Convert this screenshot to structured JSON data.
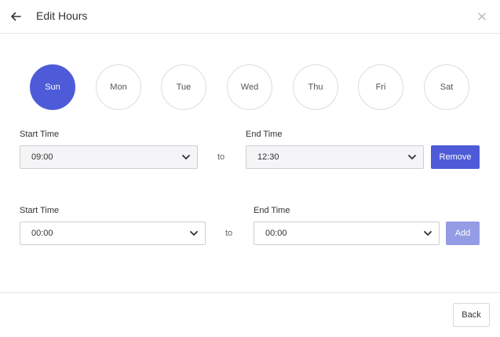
{
  "header": {
    "title": "Edit Hours",
    "back_icon": "arrow-left-icon",
    "close_icon": "close-icon"
  },
  "days": [
    {
      "label": "Sun",
      "selected": true
    },
    {
      "label": "Mon",
      "selected": false
    },
    {
      "label": "Tue",
      "selected": false
    },
    {
      "label": "Wed",
      "selected": false
    },
    {
      "label": "Thu",
      "selected": false
    },
    {
      "label": "Fri",
      "selected": false
    },
    {
      "label": "Sat",
      "selected": false
    }
  ],
  "ranges": [
    {
      "start_label": "Start Time",
      "start_value": "09:00",
      "to_label": "to",
      "end_label": "End Time",
      "end_value": "12:30",
      "action_label": "Remove"
    },
    {
      "start_label": "Start Time",
      "start_value": "00:00",
      "to_label": "to",
      "end_label": "End Time",
      "end_value": "00:00",
      "action_label": "Add"
    }
  ],
  "footer": {
    "back_label": "Back"
  },
  "colors": {
    "accent": "#4e5bd8",
    "accent_disabled": "#949ce6"
  }
}
